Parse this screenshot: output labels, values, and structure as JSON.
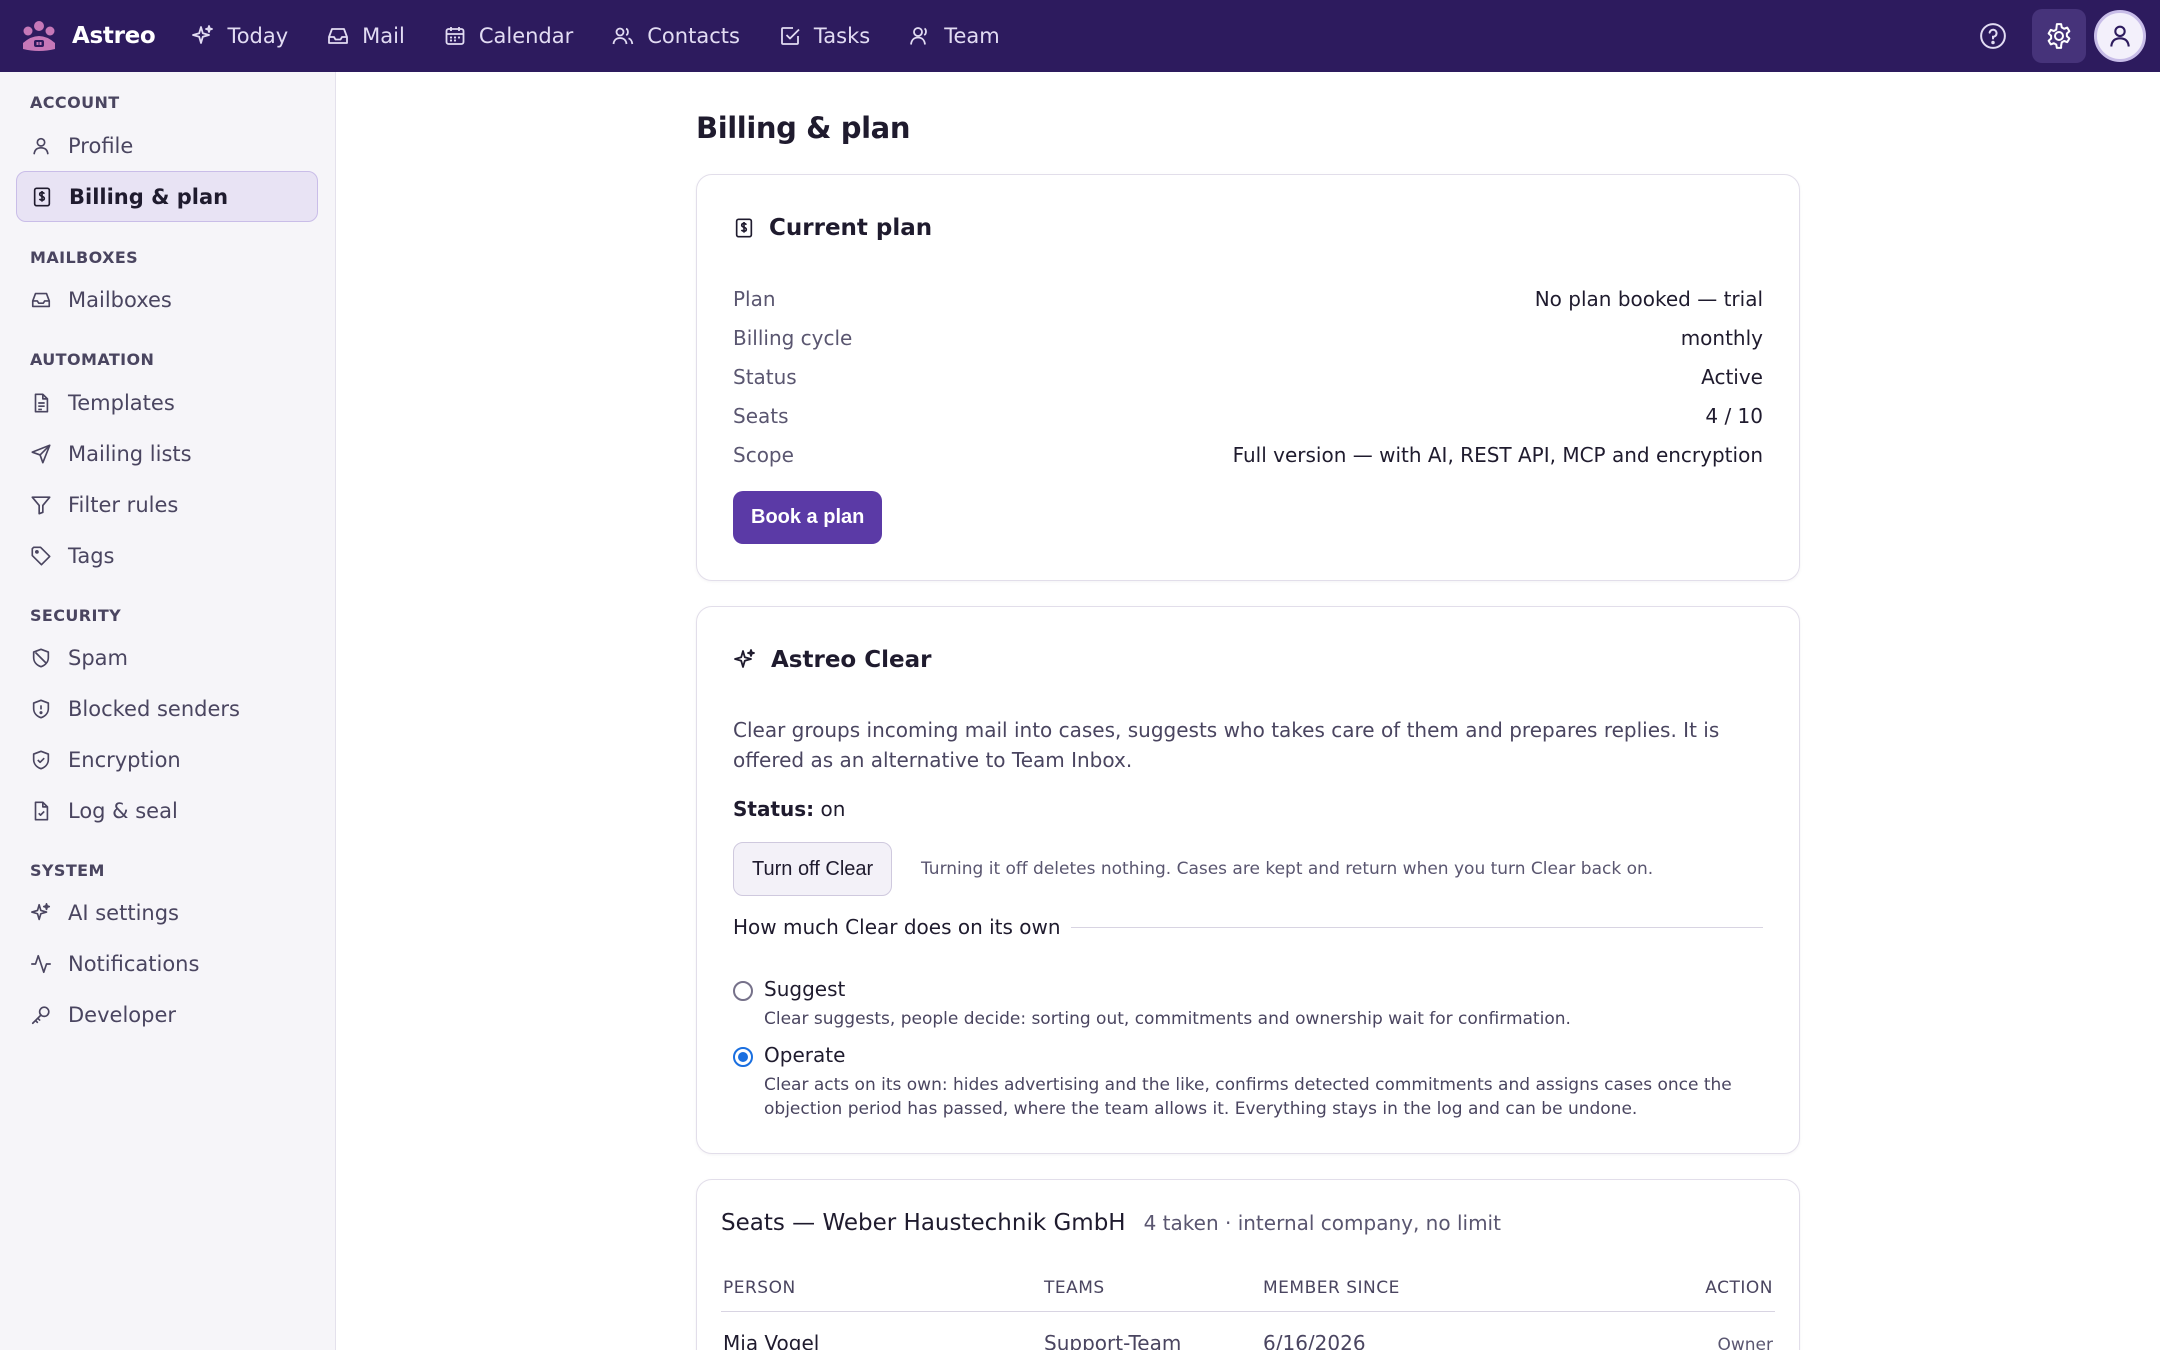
{
  "app": {
    "name": "Astreo"
  },
  "nav": [
    {
      "label": "Today",
      "icon": "sparkle-icon"
    },
    {
      "label": "Mail",
      "icon": "inbox-icon"
    },
    {
      "label": "Calendar",
      "icon": "calendar-icon"
    },
    {
      "label": "Contacts",
      "icon": "contacts-icon"
    },
    {
      "label": "Tasks",
      "icon": "check-square-icon"
    },
    {
      "label": "Team",
      "icon": "team-icon"
    }
  ],
  "sidebar": {
    "sections": [
      {
        "title": "ACCOUNT",
        "items": [
          {
            "label": "Profile",
            "icon": "user-icon"
          },
          {
            "label": "Billing & plan",
            "icon": "billing-icon",
            "active": true
          }
        ]
      },
      {
        "title": "MAILBOXES",
        "items": [
          {
            "label": "Mailboxes",
            "icon": "inbox-icon"
          }
        ]
      },
      {
        "title": "AUTOMATION",
        "items": [
          {
            "label": "Templates",
            "icon": "file-text-icon"
          },
          {
            "label": "Mailing lists",
            "icon": "send-icon"
          },
          {
            "label": "Filter rules",
            "icon": "filter-icon"
          },
          {
            "label": "Tags",
            "icon": "tag-icon"
          }
        ]
      },
      {
        "title": "SECURITY",
        "items": [
          {
            "label": "Spam",
            "icon": "shield-off-icon"
          },
          {
            "label": "Blocked senders",
            "icon": "shield-alert-icon"
          },
          {
            "label": "Encryption",
            "icon": "shield-check-icon"
          },
          {
            "label": "Log & seal",
            "icon": "file-check-icon"
          }
        ]
      },
      {
        "title": "SYSTEM",
        "items": [
          {
            "label": "AI settings",
            "icon": "sparkle-icon"
          },
          {
            "label": "Notifications",
            "icon": "activity-icon"
          },
          {
            "label": "Developer",
            "icon": "key-icon"
          }
        ]
      }
    ]
  },
  "page": {
    "title": "Billing & plan"
  },
  "current_plan": {
    "title": "Current plan",
    "rows": [
      {
        "key": "Plan",
        "value": "No plan booked — trial"
      },
      {
        "key": "Billing cycle",
        "value": "monthly"
      },
      {
        "key": "Status",
        "value": "Active"
      },
      {
        "key": "Seats",
        "value": "4 / 10"
      },
      {
        "key": "Scope",
        "value": "Full version — with AI, REST API, MCP and encryption"
      }
    ],
    "button": "Book a plan"
  },
  "clear": {
    "title": "Astreo Clear",
    "description": "Clear groups incoming mail into cases, suggests who takes care of them and prepares replies. It is offered as an alternative to Team Inbox.",
    "status_label": "Status:",
    "status_value": "on",
    "toggle_button": "Turn off Clear",
    "hint": "Turning it off deletes nothing. Cases are kept and return when you turn Clear back on.",
    "mode_legend": "How much Clear does on its own",
    "modes": [
      {
        "label": "Suggest",
        "description": "Clear suggests, people decide: sorting out, commitments and ownership wait for confirmation.",
        "selected": false
      },
      {
        "label": "Operate",
        "description": "Clear acts on its own: hides advertising and the like, confirms detected commitments and assigns cases once the objection period has passed, where the team allows it. Everything stays in the log and can be undone.",
        "selected": true
      }
    ]
  },
  "seats": {
    "title": "Seats — Weber Haustechnik GmbH",
    "subtitle": "4 taken · internal company, no limit",
    "columns": [
      "PERSON",
      "TEAMS",
      "MEMBER SINCE",
      "ACTION"
    ],
    "rows": [
      {
        "person": "Mia Vogel",
        "teams": "Support-Team",
        "member_since": "6/16/2026",
        "action": "Owner"
      }
    ]
  },
  "colors": {
    "topbar": "#2d1b5e",
    "accent": "#5b3aa6",
    "radio": "#1a6fe0"
  }
}
